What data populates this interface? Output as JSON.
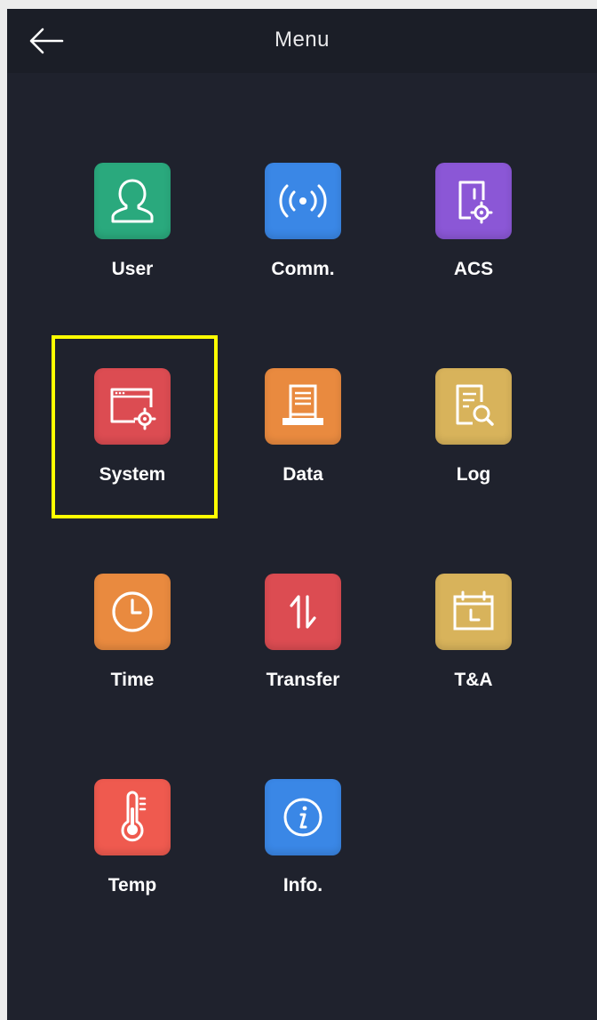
{
  "header": {
    "title": "Menu"
  },
  "menu": {
    "items": [
      {
        "label": "User",
        "icon": "user-icon",
        "color": "#2aa97d"
      },
      {
        "label": "Comm.",
        "icon": "wireless-signal-icon",
        "color": "#3a87e6"
      },
      {
        "label": "ACS",
        "icon": "door-settings-icon",
        "color": "#8b57d6"
      },
      {
        "label": "System",
        "icon": "window-settings-icon",
        "color": "#dc4c52"
      },
      {
        "label": "Data",
        "icon": "data-terminal-icon",
        "color": "#e98a3f"
      },
      {
        "label": "Log",
        "icon": "document-search-icon",
        "color": "#d8b35b"
      },
      {
        "label": "Time",
        "icon": "clock-icon",
        "color": "#e98a3f"
      },
      {
        "label": "Transfer",
        "icon": "transfer-arrows-icon",
        "color": "#dc4c52"
      },
      {
        "label": "T&A",
        "icon": "calendar-icon",
        "color": "#d8b35b"
      },
      {
        "label": "Temp",
        "icon": "thermometer-icon",
        "color": "#ef5a4f"
      },
      {
        "label": "Info.",
        "icon": "info-icon",
        "color": "#3a87e6"
      }
    ]
  },
  "highlight": {
    "item": "System",
    "color": "#ffff00"
  }
}
